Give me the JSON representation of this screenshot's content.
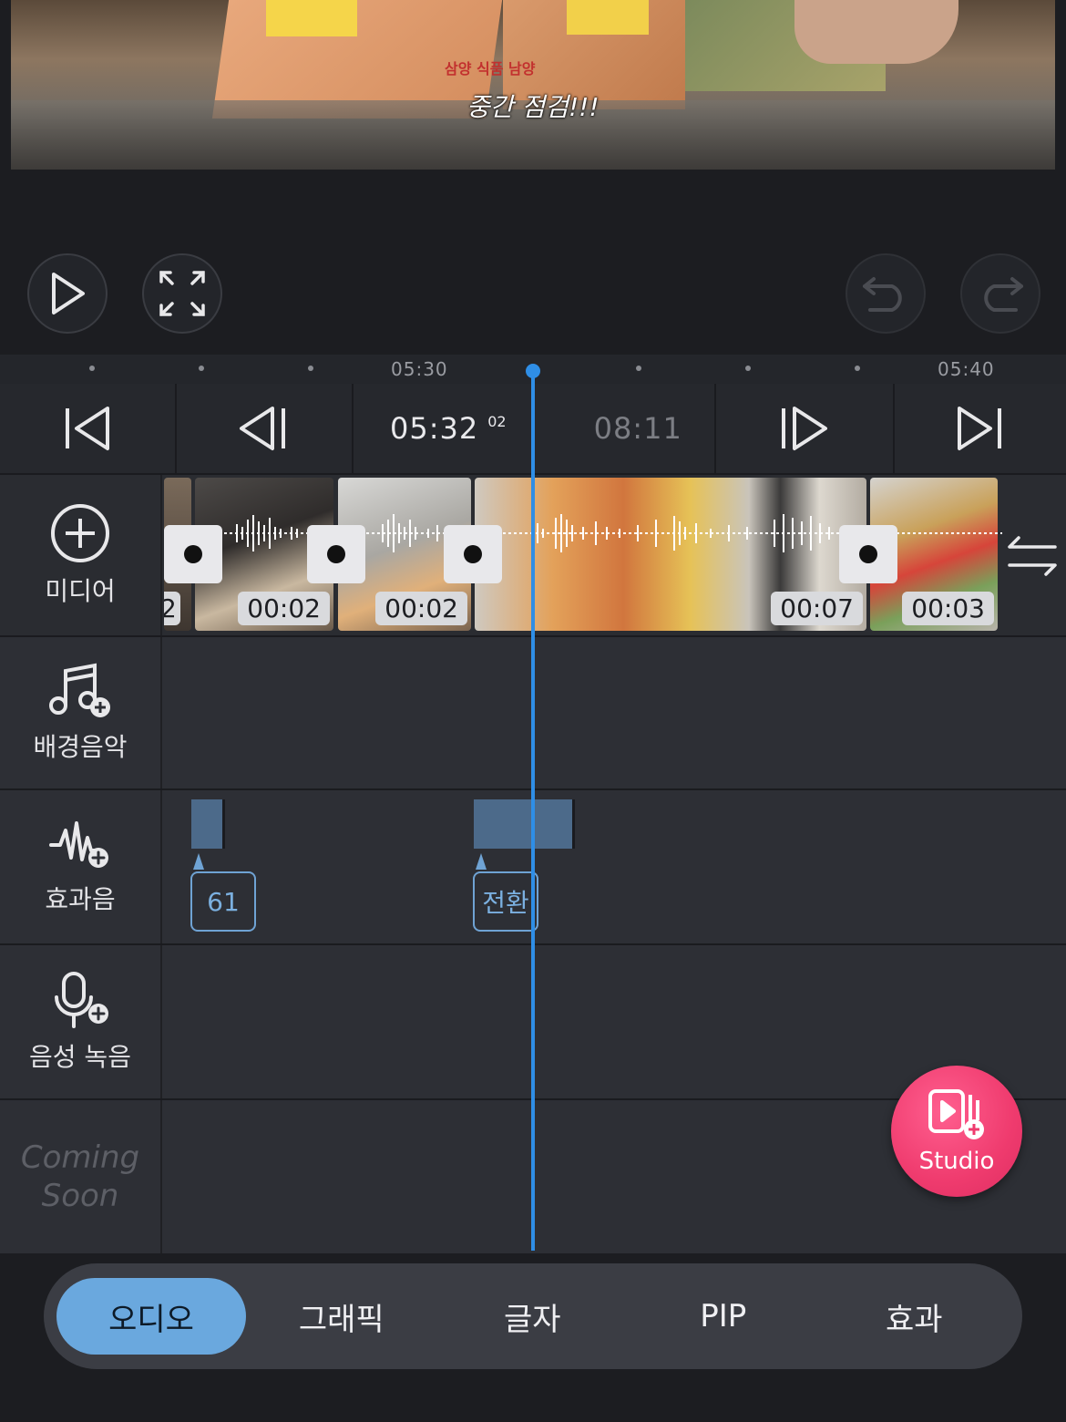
{
  "preview": {
    "caption": "중간 점검!!!",
    "brand": "삼양 식품 남양"
  },
  "ruler": {
    "labels": [
      "05:30",
      "05:40"
    ]
  },
  "transport": {
    "current_time": "05:32",
    "current_frame": "02",
    "total_time": "08:11"
  },
  "tracks": {
    "media": {
      "label": "미디어"
    },
    "bgm": {
      "label": "배경음악"
    },
    "sfx": {
      "label": "효과음",
      "tags": [
        "61",
        "전환"
      ]
    },
    "voice": {
      "label": "음성 녹음"
    },
    "coming": {
      "label": "Coming Soon"
    }
  },
  "clips": {
    "partial": "2",
    "durations": [
      "00:02",
      "00:02",
      "00:07",
      "00:03"
    ]
  },
  "studio": {
    "label": "Studio"
  },
  "tabs": [
    "오디오",
    "그래픽",
    "글자",
    "PIP",
    "효과"
  ],
  "colors": {
    "accent": "#2f8ee6",
    "active_tab": "#6aa8de",
    "studio": "#ef3b6e",
    "sfx_block": "#4c6a8a"
  }
}
